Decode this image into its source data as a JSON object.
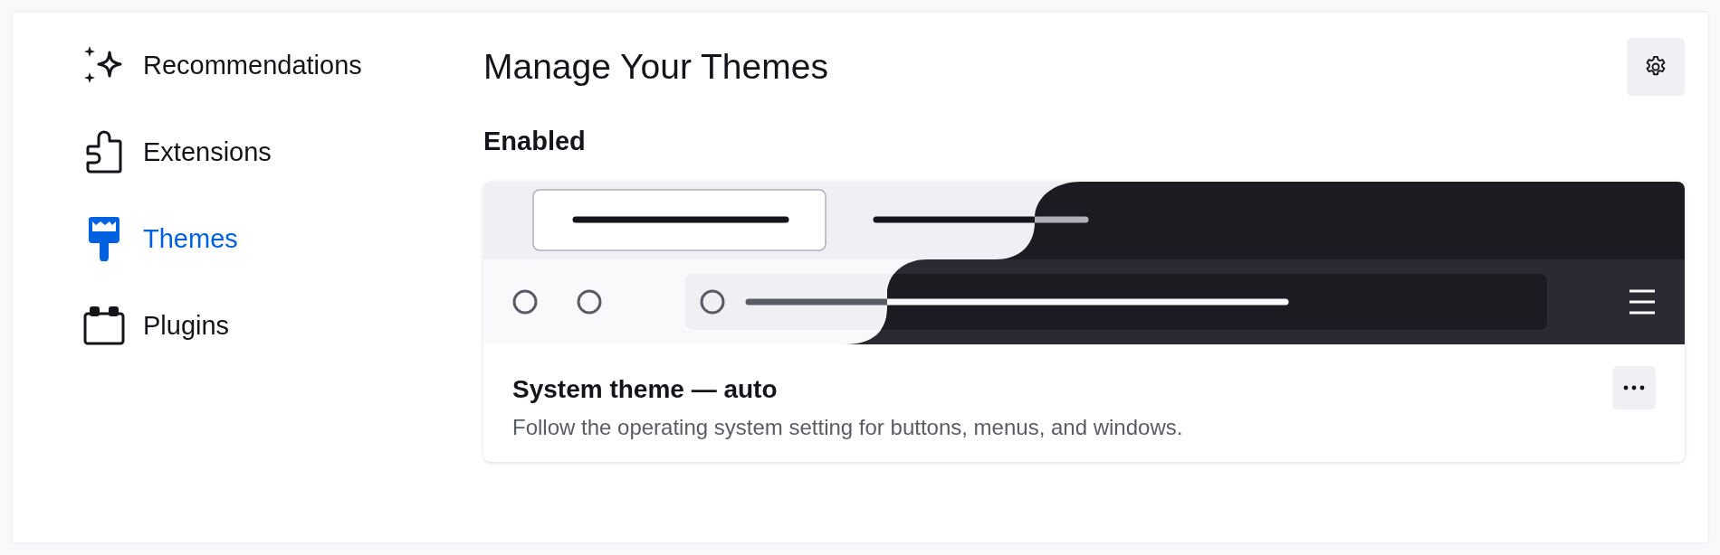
{
  "sidebar": {
    "items": [
      {
        "label": "Recommendations",
        "selected": false
      },
      {
        "label": "Extensions",
        "selected": false
      },
      {
        "label": "Themes",
        "selected": true
      },
      {
        "label": "Plugins",
        "selected": false
      }
    ]
  },
  "main": {
    "title": "Manage Your Themes",
    "sections": [
      {
        "heading": "Enabled",
        "cards": [
          {
            "kind": "picture",
            "name": "System theme — auto",
            "description": "Follow the operating system setting for buttons, menus, and windows."
          }
        ]
      }
    ]
  }
}
